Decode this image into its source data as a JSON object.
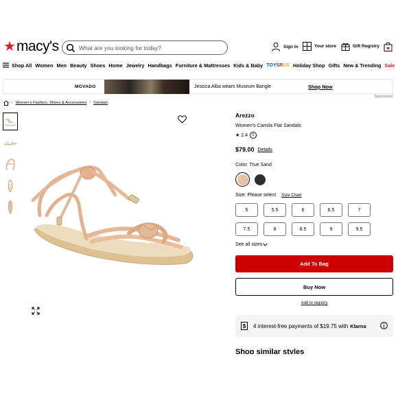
{
  "header": {
    "logo_text": "macy's",
    "search_placeholder": "What are you looking for today?",
    "sign_in": "Sign In",
    "your_store": "Your store",
    "gift_registry": "Gift Registry"
  },
  "nav": {
    "items": [
      "Shop All",
      "Women",
      "Men",
      "Beauty",
      "Shoes",
      "Home",
      "Jewelry",
      "Handbags",
      "Furniture & Mattresses",
      "Kids & Baby"
    ],
    "toysrus": [
      "TOYS",
      "R",
      "US"
    ],
    "items_after": [
      "Holiday Shop",
      "Gifts",
      "New & Trending"
    ],
    "sale": "Sale",
    "sale_color": "#e11a2b"
  },
  "banner": {
    "brand": "MOVADO",
    "text": "Jessica Alba wears Museum Bangle",
    "cta": "Shop Now",
    "sponsored": "Sponsored"
  },
  "breadcrumb": {
    "items": [
      "Women's Fashion, Shoes & Accessories",
      "Sandals"
    ]
  },
  "product": {
    "brand": "Arezzo",
    "name": "Women's Camila Flat Sandals",
    "rating": "2.4",
    "rating_count": "5",
    "price": "$79.00",
    "details_link": "Details",
    "color_label": "Color: True Sand",
    "colors": [
      {
        "name": "True Sand",
        "hex": "#e8c2a4",
        "selected": true
      },
      {
        "name": "Black",
        "hex": "#2f2f2f",
        "selected": false
      }
    ],
    "size_label": "Size: Please select",
    "size_chart": "Size Chart",
    "sizes": [
      "5",
      "5.5",
      "6",
      "6.5",
      "7",
      "7.5",
      "8",
      "8.5",
      "9",
      "9.5"
    ],
    "see_all_sizes": "See all sizes",
    "add_to_bag": "Add To Bag",
    "buy_now": "Buy Now",
    "add_to_registry": "Add to registry",
    "accent_color": "#cc0000"
  },
  "klarna": {
    "text": "4 interest-free payments of $19.75 with",
    "logo": "Klarna"
  },
  "similar": {
    "heading": "Shop similar styles"
  }
}
